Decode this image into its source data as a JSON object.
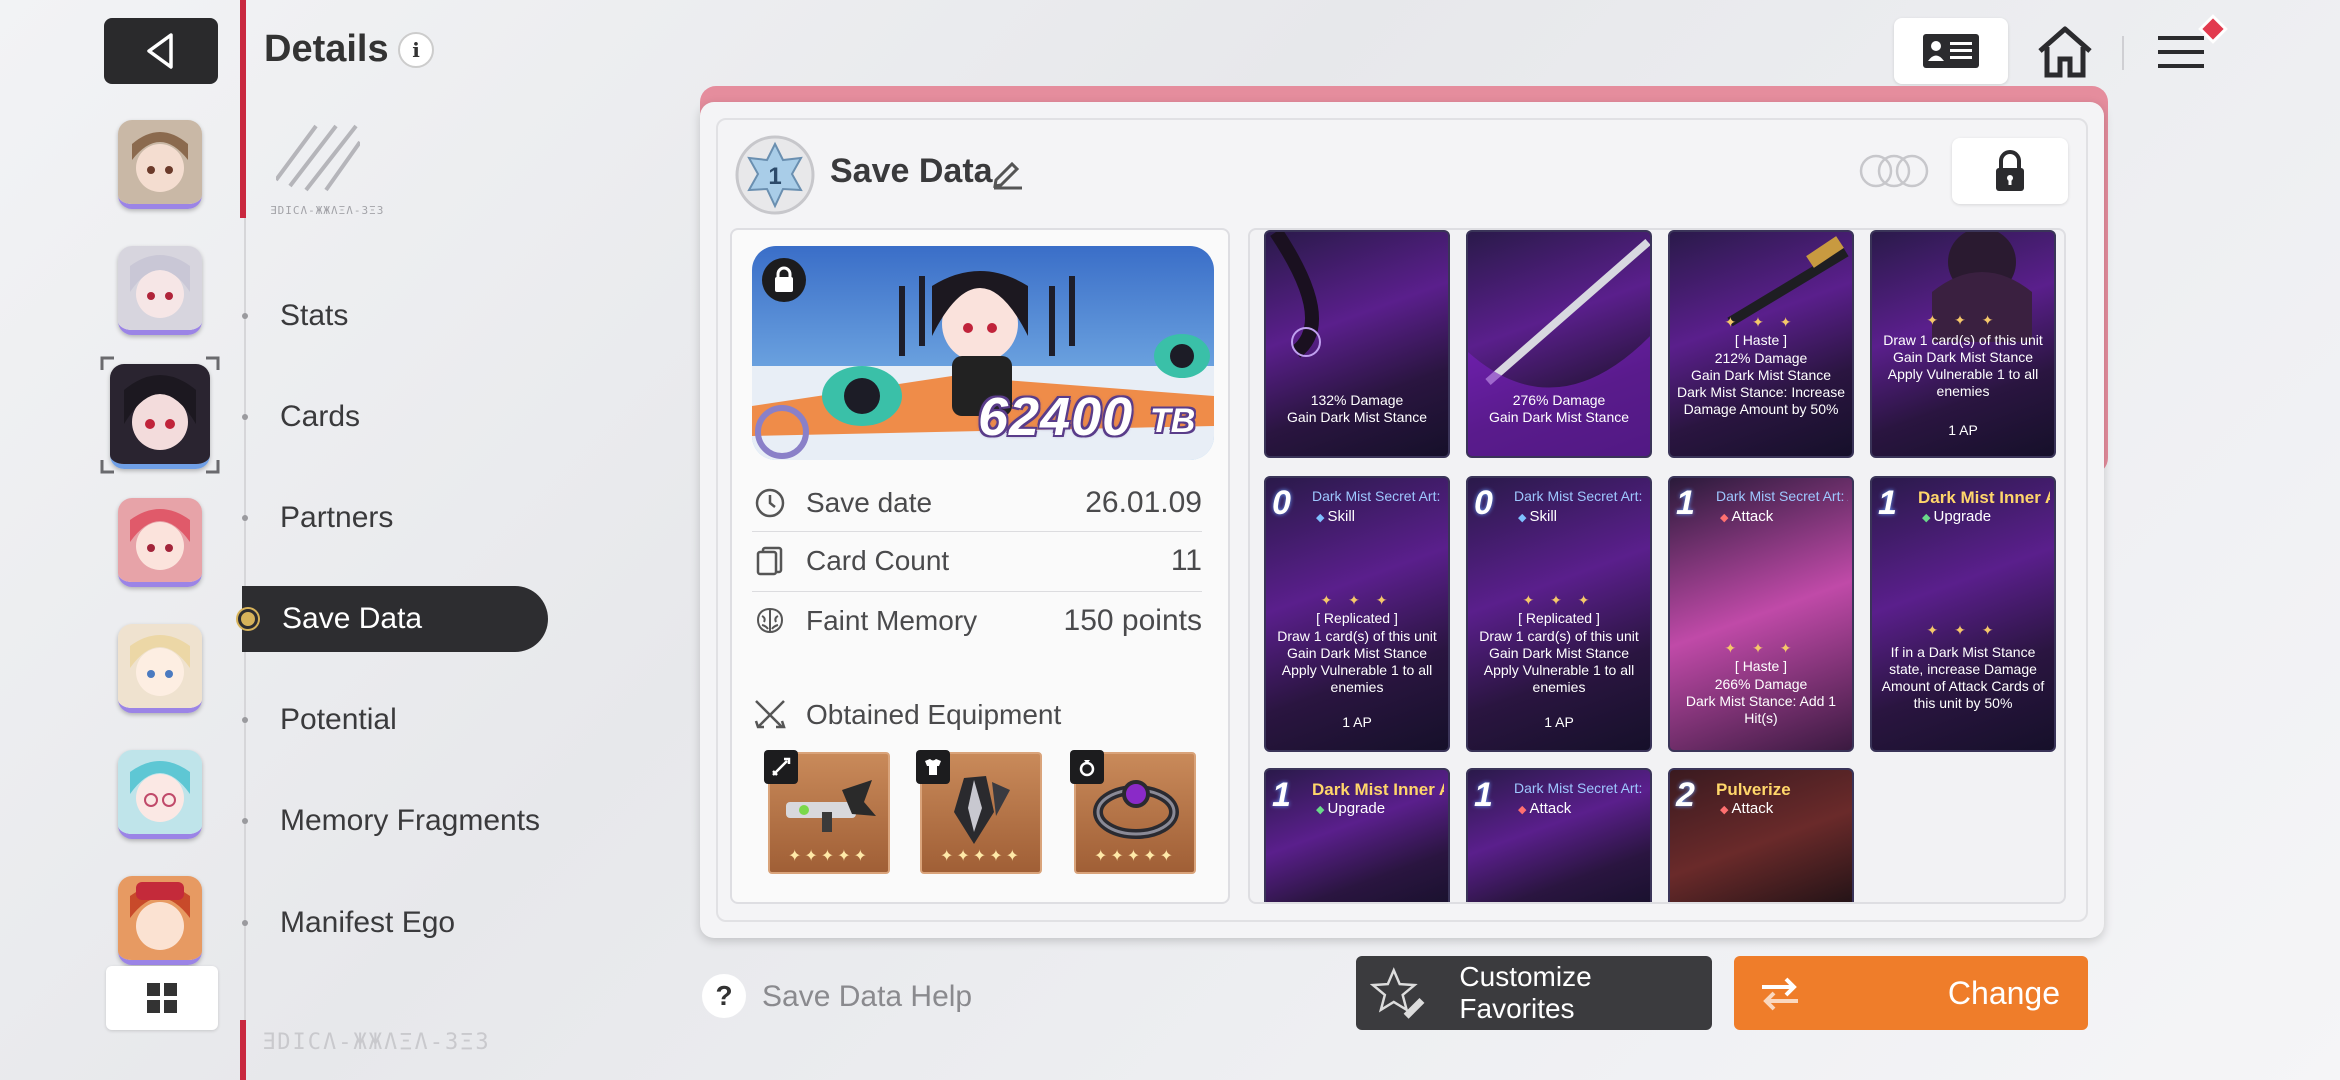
{
  "header": {
    "title": "Details",
    "logo_text": "ƎDICɅ-ЖЖɅΞɅ-ЗΞЗ",
    "footer_logo_text": "ƎDICɅ-ЖЖɅΞɅ-ЗΞЗ"
  },
  "nav": {
    "items": [
      {
        "label": "Stats"
      },
      {
        "label": "Cards"
      },
      {
        "label": "Partners"
      },
      {
        "label": "Save Data"
      },
      {
        "label": "Potential"
      },
      {
        "label": "Memory Fragments"
      },
      {
        "label": "Manifest Ego"
      }
    ],
    "active": "Save Data"
  },
  "save": {
    "rank": "1",
    "title": "Save Data",
    "tb_value": "62400",
    "tb_unit": "TB",
    "rows": [
      {
        "key": "Save date",
        "value": "26.01.09"
      },
      {
        "key": "Card Count",
        "value": "11"
      },
      {
        "key": "Faint Memory",
        "value": "150 points"
      }
    ],
    "equipment_title": "Obtained Equipment",
    "equipment_stars": "✦✦✦✦✦"
  },
  "cards": [
    {
      "text1": "132% Damage",
      "text2": "Gain Dark Mist Stance"
    },
    {
      "text1": "276% Damage",
      "text2": "Gain Dark Mist Stance"
    },
    {
      "tag": "[ Haste ]",
      "body": "212% Damage\nGain Dark Mist Stance\nDark Mist Stance: Increase Damage Amount by 50%"
    },
    {
      "body": "Draw 1 card(s) of this unit\nGain Dark Mist Stance\nApply Vulnerable 1 to all enemies",
      "ap": "1 AP"
    },
    {
      "cost": "0",
      "name": "Dark Mist Secret Art: Destruction",
      "type": "Skill",
      "tag": "[ Replicated ]",
      "body": "Draw 1 card(s) of this unit\nGain Dark Mist Stance\nApply Vulnerable 1 to all enemies",
      "ap": "1 AP"
    },
    {
      "cost": "0",
      "name": "Dark Mist Secret Art: Destruction",
      "type": "Skill",
      "tag": "[ Replicated ]",
      "body": "Draw 1 card(s) of this unit\nGain Dark Mist Stance\nApply Vulnerable 1 to all enemies",
      "ap": "1 AP"
    },
    {
      "cost": "1",
      "name": "Dark Mist Secret Art: Annihilation",
      "type": "Attack",
      "tag": "[ Haste ]",
      "body": "266% Damage\nDark Mist Stance: Add 1 Hit(s)"
    },
    {
      "cost": "1",
      "name": "Dark Mist Inner Art",
      "type": "Upgrade",
      "body": "If in a Dark Mist Stance state, increase Damage Amount of Attack Cards of this unit by 50%"
    },
    {
      "cost": "1",
      "name": "Dark Mist Inner Art",
      "type": "Upgrade"
    },
    {
      "cost": "1",
      "name": "Dark Mist Secret Art: Black Dance",
      "type": "Attack"
    },
    {
      "cost": "2",
      "name": "Pulverize",
      "type": "Attack"
    }
  ],
  "bottom": {
    "help_label": "Save Data Help",
    "favorites_label": "Customize Favorites",
    "change_label": "Change"
  },
  "colors": {
    "accent_red": "#c9283f",
    "panel_pink": "#e58d9d",
    "change_orange": "#ef7d2a",
    "dark_button": "#3b3b3e"
  }
}
